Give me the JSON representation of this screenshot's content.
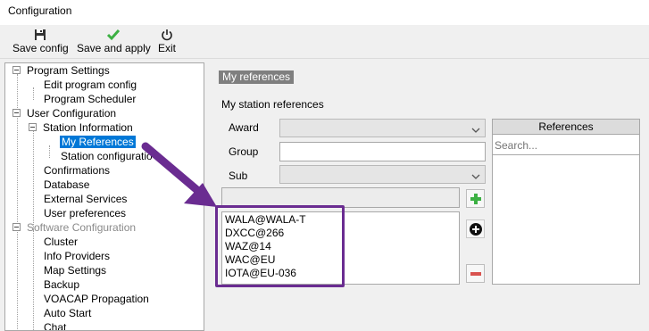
{
  "window": {
    "title": "Configuration"
  },
  "toolbar": {
    "save_config": "Save config",
    "save_apply": "Save and apply",
    "exit": "Exit"
  },
  "tree": {
    "program_settings": "Program Settings",
    "edit_program_config": "Edit program config",
    "program_scheduler": "Program Scheduler",
    "user_configuration": "User Configuration",
    "station_information": "Station Information",
    "my_references": "My References",
    "station_configuration": "Station configuratio",
    "confirmations": "Confirmations",
    "database": "Database",
    "external_services": "External Services",
    "user_preferences": "User preferences",
    "software_configuration": "Software Configuration",
    "cluster": "Cluster",
    "info_providers": "Info Providers",
    "map_settings": "Map Settings",
    "backup": "Backup",
    "voacap": "VOACAP Propagation",
    "auto_start": "Auto Start",
    "chat": "Chat"
  },
  "panel": {
    "tag": "My references",
    "heading": "My station references",
    "award_label": "Award",
    "group_label": "Group",
    "sub_label": "Sub",
    "award_value": "",
    "group_value": "",
    "sub_value": "",
    "new_reference_value": ""
  },
  "references_list": [
    "WALA@WALA-T",
    "DXCC@266",
    "WAZ@14",
    "WAC@EU",
    "IOTA@EU-036"
  ],
  "references_panel": {
    "header": "References",
    "search_placeholder": "Search..."
  },
  "colors": {
    "selection": "#0078d7",
    "annotation": "#6a2c91",
    "add": "#3cb043",
    "remove": "#d9534f"
  }
}
